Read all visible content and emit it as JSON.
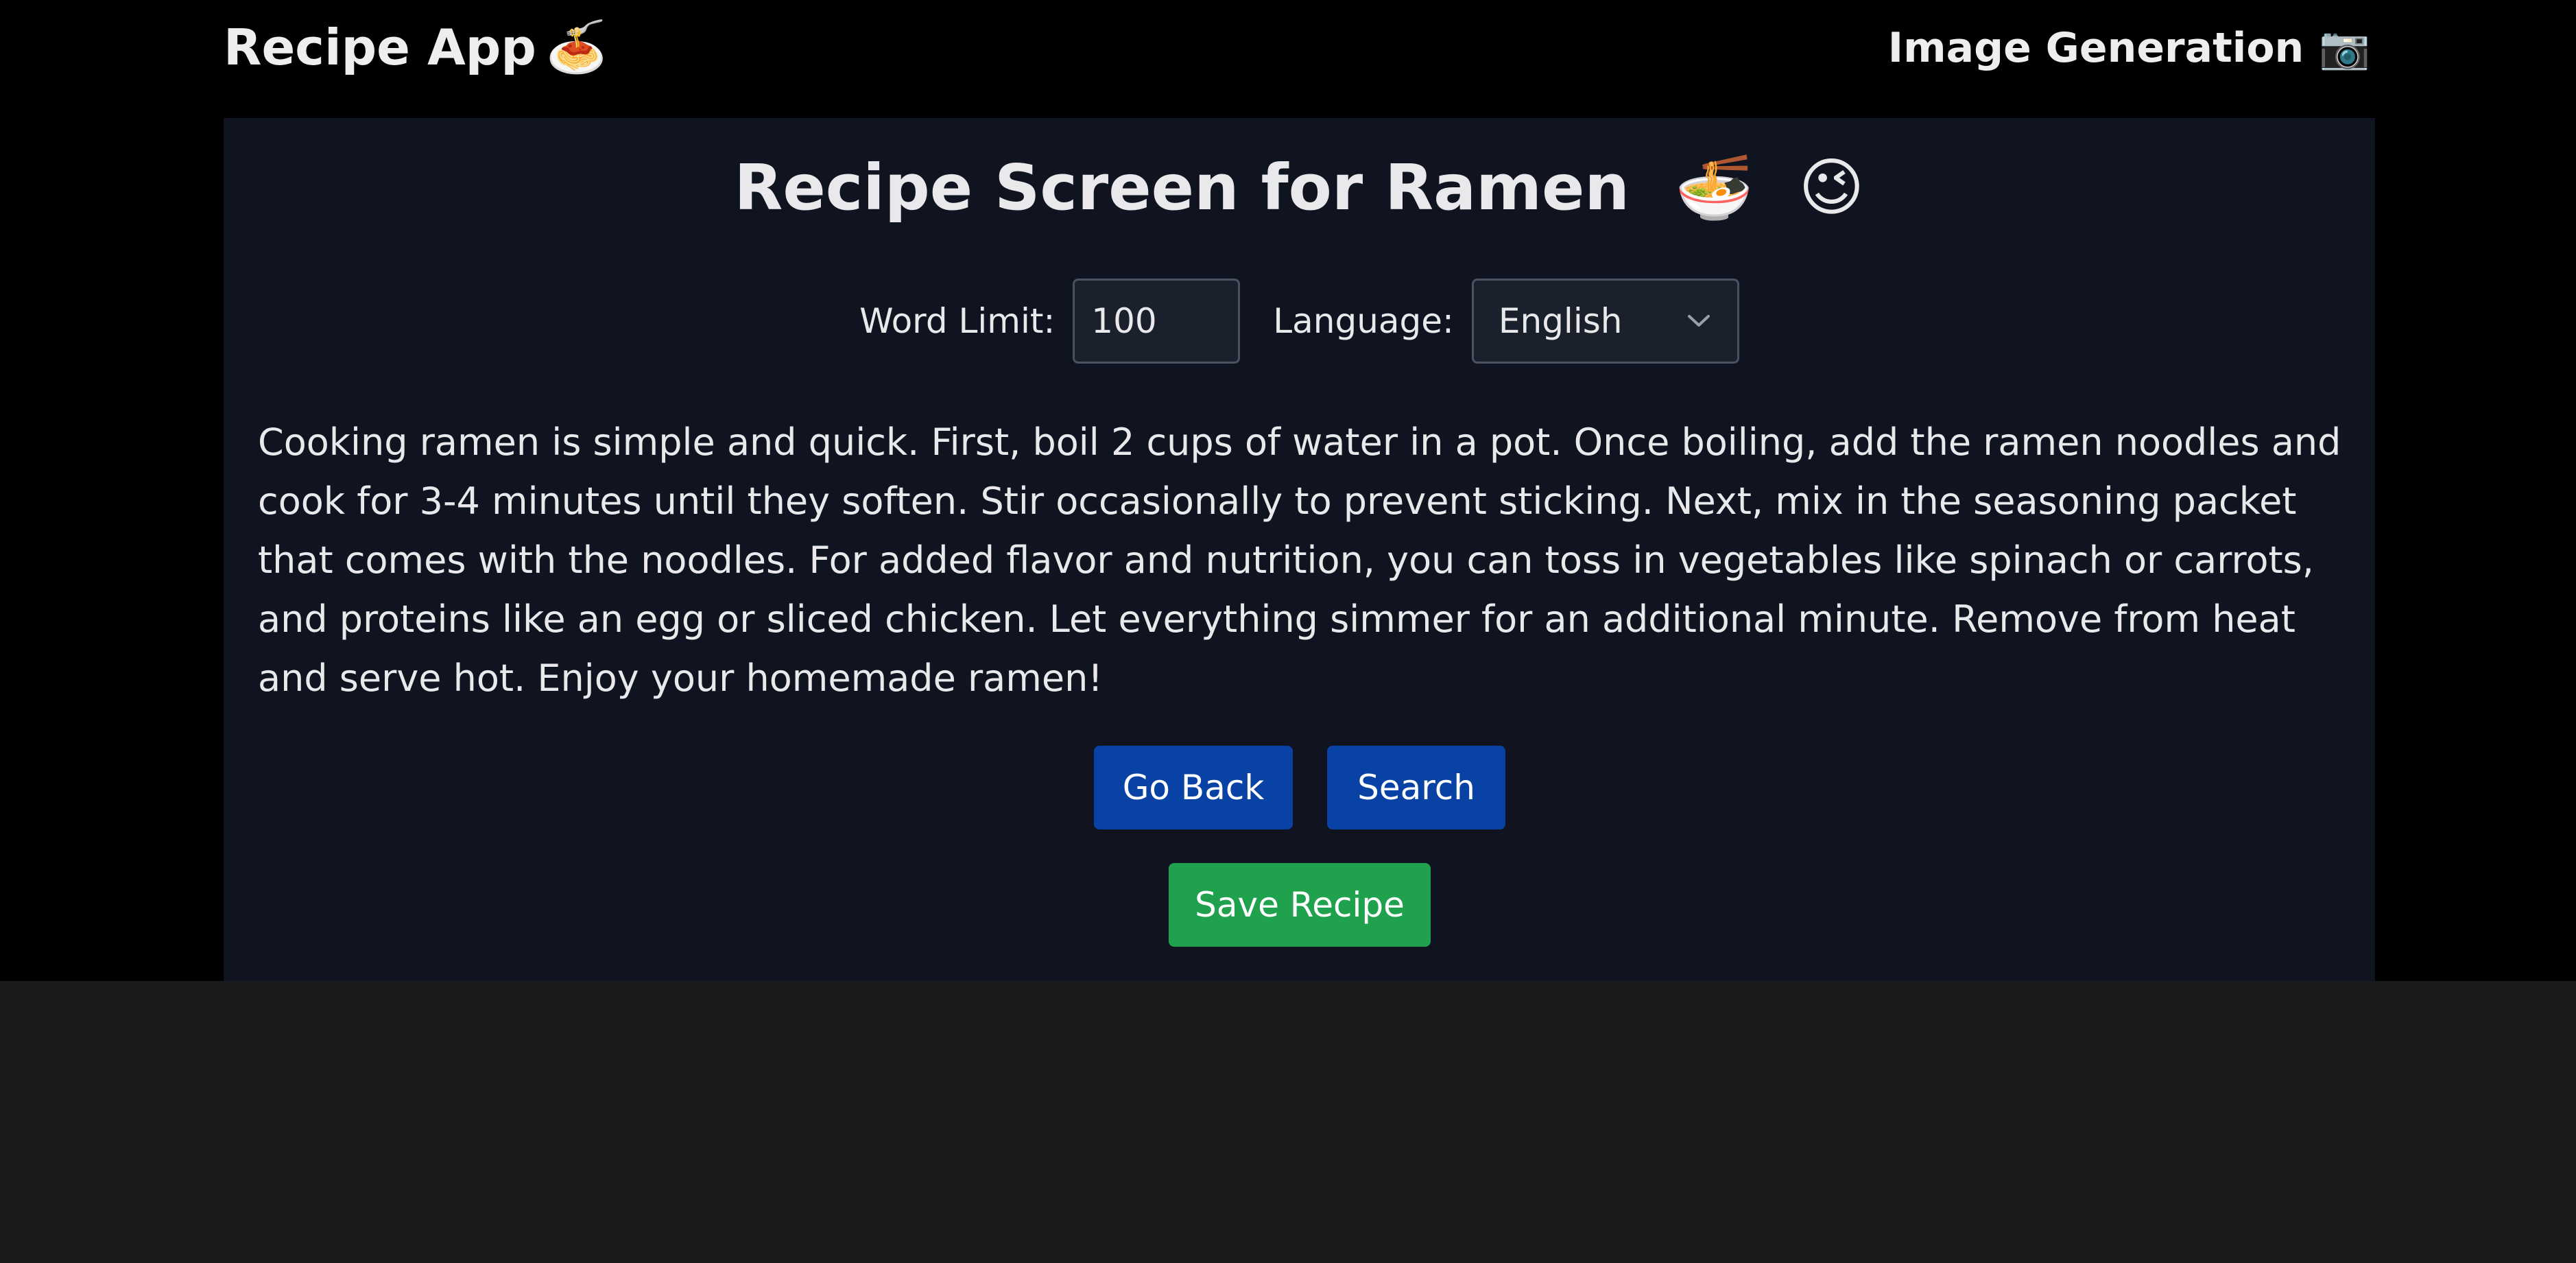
{
  "header": {
    "brand": "Recipe App",
    "brand_emoji": "🍝",
    "nav_link": "Image Generation",
    "nav_emoji": "📷"
  },
  "main": {
    "title": "Recipe Screen for Ramen",
    "title_emoji_1": "🍜",
    "title_emoji_2": "😉",
    "word_limit_label": "Word Limit:",
    "word_limit_value": "100",
    "language_label": "Language:",
    "language_value": "English",
    "recipe_text": "Cooking ramen is simple and quick. First, boil 2 cups of water in a pot. Once boiling, add the ramen noodles and cook for 3-4 minutes until they soften. Stir occasionally to prevent sticking. Next, mix in the seasoning packet that comes with the noodles. For added flavor and nutrition, you can toss in vegetables like spinach or carrots, and proteins like an egg or sliced chicken. Let everything simmer for an additional minute. Remove from heat and serve hot. Enjoy your homemade ramen!",
    "go_back_label": "Go Back",
    "search_label": "Search",
    "save_label": "Save Recipe"
  },
  "icons": {
    "select_arrow": "chevron-down-icon"
  },
  "colors": {
    "page_bg": "#1a1b1c",
    "header_bg": "#000000",
    "panel_bg": "#101421",
    "primary_button": "#0842a4",
    "success_button": "#1fa14d",
    "text": "#e9e9ec"
  }
}
